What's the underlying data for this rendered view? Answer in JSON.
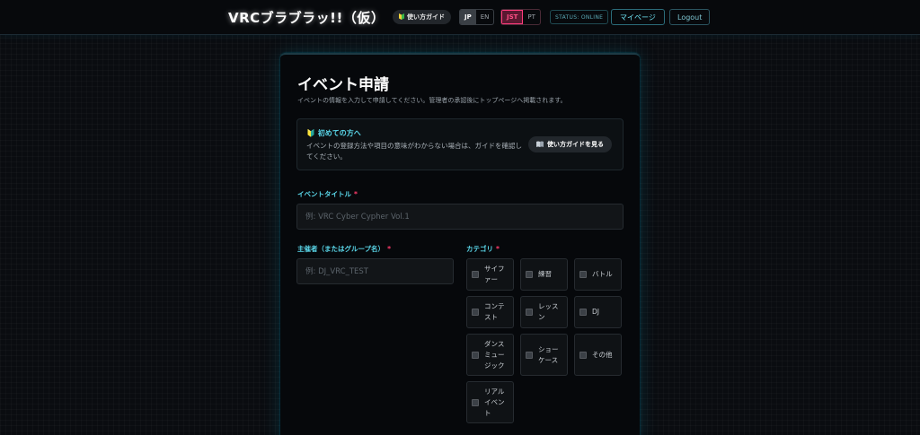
{
  "header": {
    "brand": "VRCブラブラッ!!（仮）",
    "guide_label": "使い方ガイド",
    "lang_options": [
      "JP",
      "EN"
    ],
    "tz_options": [
      "JST",
      "PT"
    ],
    "status": "STATUS: ONLINE",
    "mypage_label": "マイページ",
    "logout_label": "Logout"
  },
  "form": {
    "title": "イベント申請",
    "subtitle": "イベントの情報を入力して申請してください。管理者の承認後にトップページへ掲載されます。",
    "notice": {
      "title": "🔰 初めての方へ",
      "body": "イベントの登録方法や項目の意味がわからない場合は、ガイドを確認してください。",
      "button_label": "使い方ガイドを見る"
    },
    "event_title": {
      "label": "イベントタイトル",
      "required": "*",
      "placeholder": "例: VRC Cyber Cypher Vol.1"
    },
    "organizer": {
      "label": "主催者（またはグループ名）",
      "required": "*",
      "placeholder": "例: DJ_VRC_TEST"
    },
    "category": {
      "label": "カテゴリ",
      "required": "*",
      "options": [
        "サイファー",
        "練習",
        "バトル",
        "コンテスト",
        "レッスン",
        "DJ",
        "ダンスミュージック",
        "ショーケース",
        "その他",
        "リアルイベント"
      ]
    }
  },
  "colors": {
    "accent": "#5ad7ea",
    "required": "#ff3b6b",
    "tz_active": "#ff3b7c",
    "background": "#0a0c10"
  },
  "icons": {
    "guide": "beginner-leaf-icon",
    "notice_button": "book-icon"
  }
}
